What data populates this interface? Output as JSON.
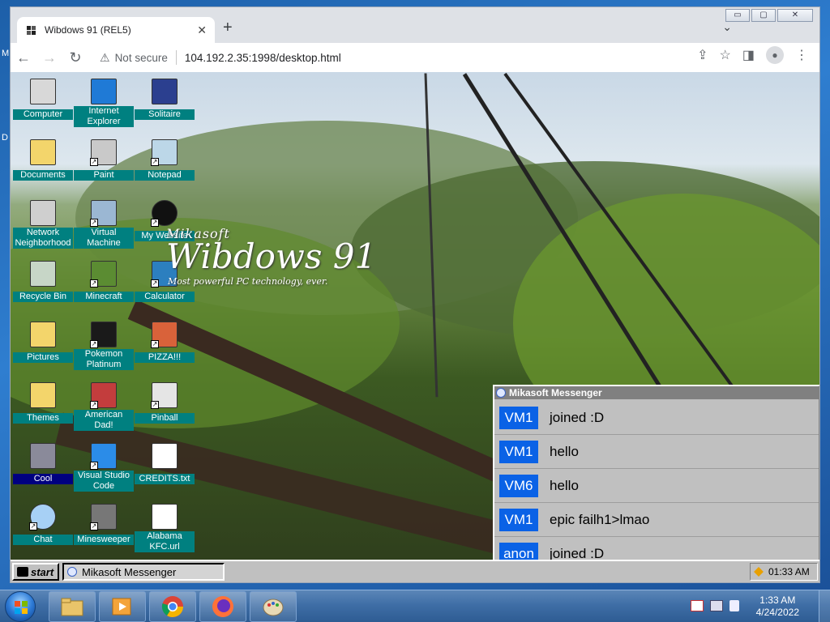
{
  "host": {
    "left_fragments": [
      "M",
      "D"
    ]
  },
  "browser": {
    "tab_title": "Wibdows 91 (REL5)",
    "tab_close": "✕",
    "new_tab": "+",
    "tab_menu": "⌄",
    "window_controls": {
      "minimize": "▭",
      "maximize": "▢",
      "close": "✕"
    },
    "nav": {
      "back": "←",
      "forward": "→",
      "reload": "↻"
    },
    "security_icon": "⚠",
    "security_text": "Not secure",
    "url": "104.192.2.35:1998/desktop.html",
    "toolbar_icons": {
      "share": "⇪",
      "bookmark": "☆",
      "sidepanel": "◨",
      "profile": "●",
      "menu": "⋮"
    }
  },
  "desktop": {
    "icons": [
      {
        "label": "Computer",
        "icon": "computer-icon",
        "shortcut": false
      },
      {
        "label": "Internet Explorer",
        "icon": "internet-explorer-icon",
        "shortcut": false
      },
      {
        "label": "Solitaire",
        "icon": "solitaire-icon",
        "shortcut": false
      },
      {
        "label": "Documents",
        "icon": "documents-folder-icon",
        "shortcut": false
      },
      {
        "label": "Paint",
        "icon": "paint-icon",
        "shortcut": true
      },
      {
        "label": "Notepad",
        "icon": "notepad-icon",
        "shortcut": true
      },
      {
        "label": "Network Neighborhood",
        "icon": "network-icon",
        "shortcut": false
      },
      {
        "label": "Virtual Machine",
        "icon": "virtual-machine-icon",
        "shortcut": true
      },
      {
        "label": "My Website",
        "icon": "github-icon",
        "shortcut": true
      },
      {
        "label": "Recycle Bin",
        "icon": "recycle-bin-icon",
        "shortcut": false
      },
      {
        "label": "Minecraft",
        "icon": "minecraft-icon",
        "shortcut": true
      },
      {
        "label": "Calculator",
        "icon": "calculator-icon",
        "shortcut": true
      },
      {
        "label": "Pictures",
        "icon": "pictures-folder-icon",
        "shortcut": false
      },
      {
        "label": "Pokemon Platinum",
        "icon": "pokemon-icon",
        "shortcut": true
      },
      {
        "label": "PIZZA!!!",
        "icon": "pizza-icon",
        "shortcut": true
      },
      {
        "label": "Themes",
        "icon": "themes-folder-icon",
        "shortcut": false
      },
      {
        "label": "American Dad!",
        "icon": "american-flag-icon",
        "shortcut": true
      },
      {
        "label": "Pinball",
        "icon": "pinball-icon",
        "shortcut": true
      },
      {
        "label": "Cool",
        "icon": "cool-folder-icon",
        "shortcut": false,
        "selected": true
      },
      {
        "label": "Visual Studio Code",
        "icon": "vscode-icon",
        "shortcut": true
      },
      {
        "label": "CREDITS.txt",
        "icon": "text-file-icon",
        "shortcut": false
      },
      {
        "label": "Chat",
        "icon": "chat-icon",
        "shortcut": true
      },
      {
        "label": "Minesweeper",
        "icon": "minesweeper-icon",
        "shortcut": true
      },
      {
        "label": "Alabama KFC.url",
        "icon": "url-file-icon",
        "shortcut": false
      }
    ],
    "logo": {
      "brand": "Mikasoft",
      "name": "Wibdows 91",
      "tagline": "Most powerful PC technology, ever."
    }
  },
  "messenger": {
    "title": "Mikasoft Messenger",
    "messages": [
      {
        "user": "VM1",
        "text": "joined :D"
      },
      {
        "user": "VM1",
        "text": "hello"
      },
      {
        "user": "VM6",
        "text": "hello"
      },
      {
        "user": "VM1",
        "text": "epic failh1>lmao"
      },
      {
        "user": "anon",
        "text": "joined :D"
      }
    ]
  },
  "w91_taskbar": {
    "start_label": "start",
    "task_label": "Mikasoft Messenger",
    "time": "01:33 AM"
  },
  "win7_taskbar": {
    "pinned": [
      "explorer-icon",
      "media-player-icon",
      "chrome-icon",
      "firefox-icon",
      "paint-icon"
    ],
    "time": "1:33 AM",
    "date": "4/24/2022"
  },
  "colors": {
    "icon_label_bg": "#008080",
    "selected_label_bg": "#000080",
    "messenger_user_bg": "#0a62e6",
    "w95_gray": "#c0c0c0"
  }
}
